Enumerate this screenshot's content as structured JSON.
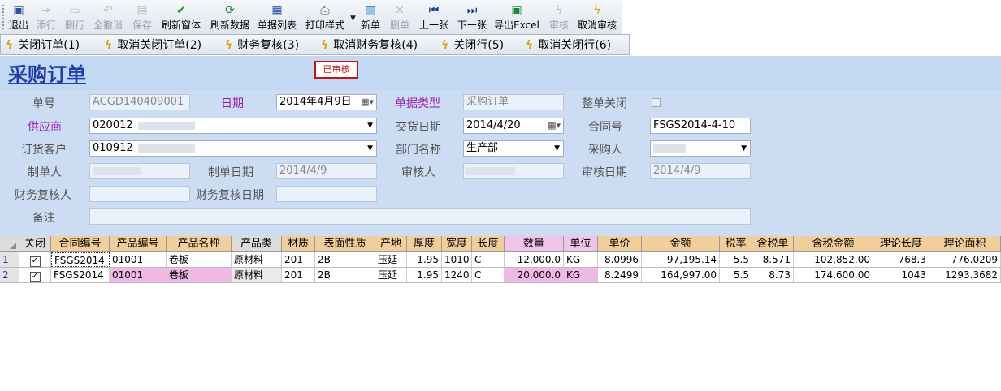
{
  "toolbar1": {
    "buttons": [
      {
        "label": "退出",
        "icon": "exit-icon",
        "enabled": true
      },
      {
        "label": "添行",
        "icon": "add-row-icon",
        "enabled": false
      },
      {
        "label": "删行",
        "icon": "delete-row-icon",
        "enabled": false
      },
      {
        "label": "全撤消",
        "icon": "undo-icon",
        "enabled": false
      },
      {
        "label": "保存",
        "icon": "save-icon",
        "enabled": false
      },
      {
        "label": "刷新窗体",
        "icon": "check-icon",
        "enabled": true
      },
      {
        "label": "刷新数据",
        "icon": "refresh-icon",
        "enabled": true
      },
      {
        "label": "单据列表",
        "icon": "list-icon",
        "enabled": true
      },
      {
        "label": "打印样式",
        "icon": "printer-icon",
        "enabled": true
      },
      {
        "label": "新单",
        "icon": "new-doc-icon",
        "enabled": true
      },
      {
        "label": "删单",
        "icon": "delete-doc-icon",
        "enabled": false
      },
      {
        "label": "上一张",
        "icon": "prev-icon",
        "enabled": true
      },
      {
        "label": "下一张",
        "icon": "next-icon",
        "enabled": true
      },
      {
        "label": "导出Excel",
        "icon": "excel-icon",
        "enabled": true
      },
      {
        "label": "审核",
        "icon": "approve-icon",
        "enabled": false
      },
      {
        "label": "取消审核",
        "icon": "unapprove-icon",
        "enabled": true
      }
    ]
  },
  "toolbar2": {
    "buttons": [
      {
        "label": "关闭订单(1)"
      },
      {
        "label": "取消关闭订单(2)"
      },
      {
        "label": "财务复核(3)"
      },
      {
        "label": "取消财务复核(4)"
      },
      {
        "label": "关闭行(5)"
      },
      {
        "label": "取消关闭行(6)"
      }
    ]
  },
  "header": {
    "title": "采购订单",
    "status_stamp": "已审核"
  },
  "form": {
    "order_no_label": "单号",
    "order_no": "ACGD140409001",
    "date_label": "日期",
    "date": "2014年4月9日",
    "doc_type_label": "单据类型",
    "doc_type": "采购订单",
    "close_all_label": "整单关闭",
    "supplier_label": "供应商",
    "supplier": "020012",
    "delivery_date_label": "交货日期",
    "delivery_date": "2014/4/20",
    "contract_no_label": "合同号",
    "contract_no": "FSGS2014-4-10",
    "customer_label": "订货客户",
    "customer": "010912",
    "dept_label": "部门名称",
    "dept": "生产部",
    "buyer_label": "采购人",
    "creator_label": "制单人",
    "create_date_label": "制单日期",
    "create_date": "2014/4/9",
    "reviewer_label": "审核人",
    "review_date_label": "审核日期",
    "review_date": "2014/4/9",
    "fin_reviewer_label": "财务复核人",
    "fin_review_date_label": "财务复核日期",
    "remark_label": "备注"
  },
  "grid": {
    "columns": [
      "关闭",
      "合同编号",
      "产品编号",
      "产品名称",
      "产品类",
      "材质",
      "表面性质",
      "产地",
      "厚度",
      "宽度",
      "长度",
      "数量",
      "单位",
      "单价",
      "金额",
      "税率",
      "含税单",
      "含税金额",
      "理论长度",
      "理论面积"
    ],
    "rows": [
      {
        "no": "1",
        "closed": "✓",
        "contract": "FSGS2014",
        "product_code": "01001",
        "product_name": "卷板",
        "category": "原材料",
        "material": "201",
        "surface": "2B",
        "origin": "压延",
        "thickness": "1.95",
        "width": "1010",
        "length": "C",
        "qty": "12,000.0",
        "unit": "KG",
        "price": "8.0996",
        "amount": "97,195.14",
        "tax_rate": "5.5",
        "tax_price": "8.571",
        "tax_amount": "102,852.00",
        "theo_len": "768.3",
        "theo_area": "776.0209"
      },
      {
        "no": "2",
        "closed": "✓",
        "contract": "FSGS2014",
        "product_code": "01001",
        "product_name": "卷板",
        "category": "原材料",
        "material": "201",
        "surface": "2B",
        "origin": "压延",
        "thickness": "1.95",
        "width": "1240",
        "length": "C",
        "qty": "20,000.0",
        "unit": "KG",
        "price": "8.2499",
        "amount": "164,997.00",
        "tax_rate": "5.5",
        "tax_price": "8.73",
        "tax_amount": "174,600.00",
        "theo_len": "1043",
        "theo_area": "1293.3682"
      }
    ]
  }
}
